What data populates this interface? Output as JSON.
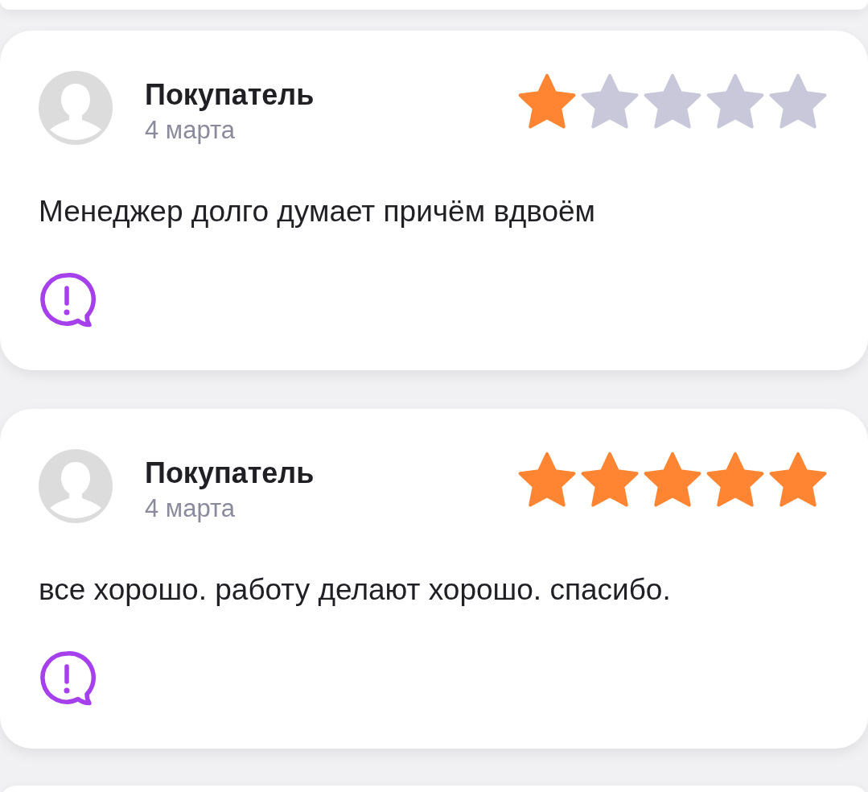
{
  "reviews": [
    {
      "author": "Покупатель",
      "date": "4 марта",
      "stars": 1,
      "text": "Менеджер долго думает причём вдвоём"
    },
    {
      "author": "Покупатель",
      "date": "4 марта",
      "stars": 5,
      "text": "все хорошо. работу делают хорошо. спасибо."
    }
  ]
}
